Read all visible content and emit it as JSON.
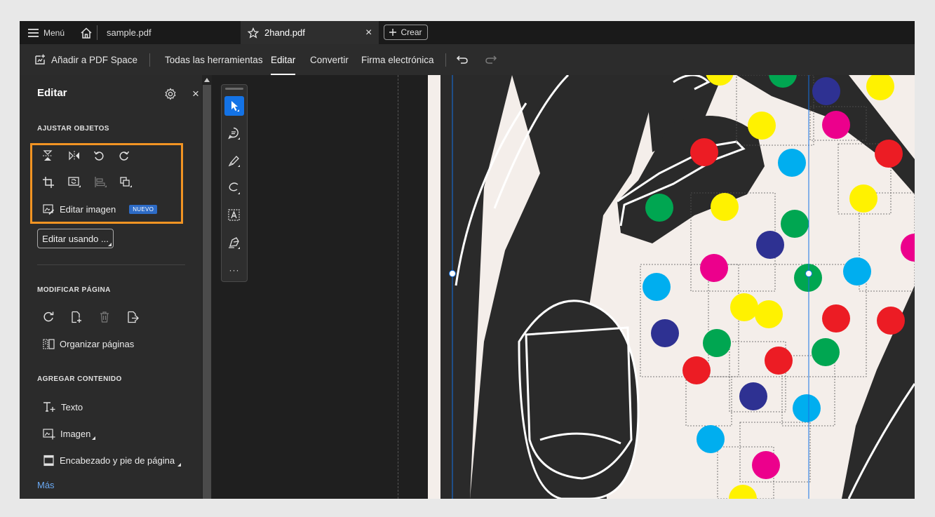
{
  "tabbar": {
    "menu_label": "Menú",
    "tab1": "sample.pdf",
    "tab2": "2hand.pdf",
    "new_tab": "Crear",
    "close_glyph": "×"
  },
  "toolbar": {
    "add_space": "Añadir a PDF Space",
    "all_tools": "Todas las herramientas",
    "edit": "Editar",
    "convert": "Convertir",
    "esign": "Firma electrónica"
  },
  "panel": {
    "title": "Editar",
    "close_glyph": "×",
    "adjust_objects": "AJUSTAR OBJETOS",
    "edit_image": "Editar imagen",
    "new_badge": "NUEVO",
    "edit_using": "Editar usando ...",
    "modify_page": "MODIFICAR PÁGINA",
    "organize_pages": "Organizar páginas",
    "add_content": "AGREGAR CONTENIDO",
    "text": "Texto",
    "image": "Imagen",
    "header_footer": "Encabezado y pie de página",
    "more": "Más"
  },
  "vertical_tools": {
    "more_glyph": "···",
    "tools": [
      "select-tool",
      "comment-tool",
      "highlight-tool",
      "draw-tool",
      "text-recognition-tool",
      "sign-tool"
    ]
  },
  "colors": {
    "accent_blue": "#1473e6",
    "highlight_orange": "#f29423",
    "badge_blue": "#2d6bc6",
    "link_blue": "#6aa9f3",
    "dot_yellow": "#fff200",
    "dot_red": "#ec1c24",
    "dot_green": "#00a651",
    "dot_blue": "#00aeef",
    "dot_navy": "#2e3192",
    "dot_magenta": "#ec008c"
  },
  "icons": {
    "tabbar": [
      "hamburger-menu-icon",
      "home-icon",
      "star-icon",
      "plus-icon"
    ],
    "toolbar": [
      "add-space-icon",
      "undo-icon",
      "redo-icon"
    ],
    "adjust": [
      "flip-vertical-icon",
      "flip-horizontal-icon",
      "rotate-left-icon",
      "rotate-right-icon",
      "crop-icon",
      "replace-image-icon",
      "align-icon",
      "arrange-icon",
      "edit-image-icon"
    ],
    "modify": [
      "rotate-page-icon",
      "insert-page-icon",
      "delete-page-icon",
      "extract-page-icon",
      "organize-pages-icon"
    ],
    "content": [
      "text-add-icon",
      "image-add-icon",
      "header-footer-icon"
    ]
  }
}
